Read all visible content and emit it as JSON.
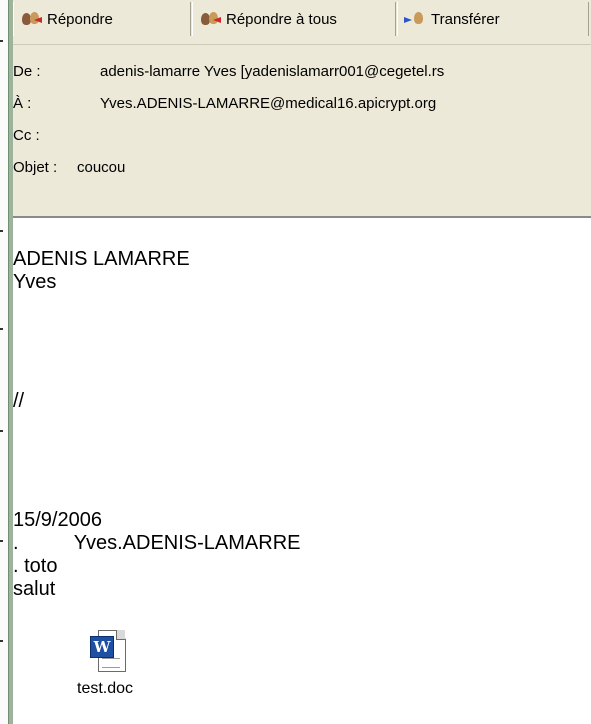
{
  "toolbar": {
    "buttons": [
      {
        "label": "Répondre",
        "icon": "reply-icon"
      },
      {
        "label": "Répondre à tous",
        "icon": "reply-all-icon"
      },
      {
        "label": "Transférer",
        "icon": "forward-icon"
      }
    ]
  },
  "header": {
    "from_label": "De :",
    "from_value": "adenis-lamarre Yves [yadenislamarr001@cegetel.rs",
    "to_label": "À :",
    "to_value": "Yves.ADENIS-LAMARRE@medical16.apicrypt.org",
    "cc_label": "Cc :",
    "cc_value": "",
    "subject_label": "Objet :",
    "subject_value": "coucou"
  },
  "message": {
    "lines": [
      "ADENIS LAMARRE",
      "Yves",
      "//",
      "15/9/2006",
      ".          Yves.ADENIS-LAMARRE",
      ". toto",
      "salut"
    ]
  },
  "attachment": {
    "filename": "test.doc",
    "icon": "word-document-icon"
  }
}
